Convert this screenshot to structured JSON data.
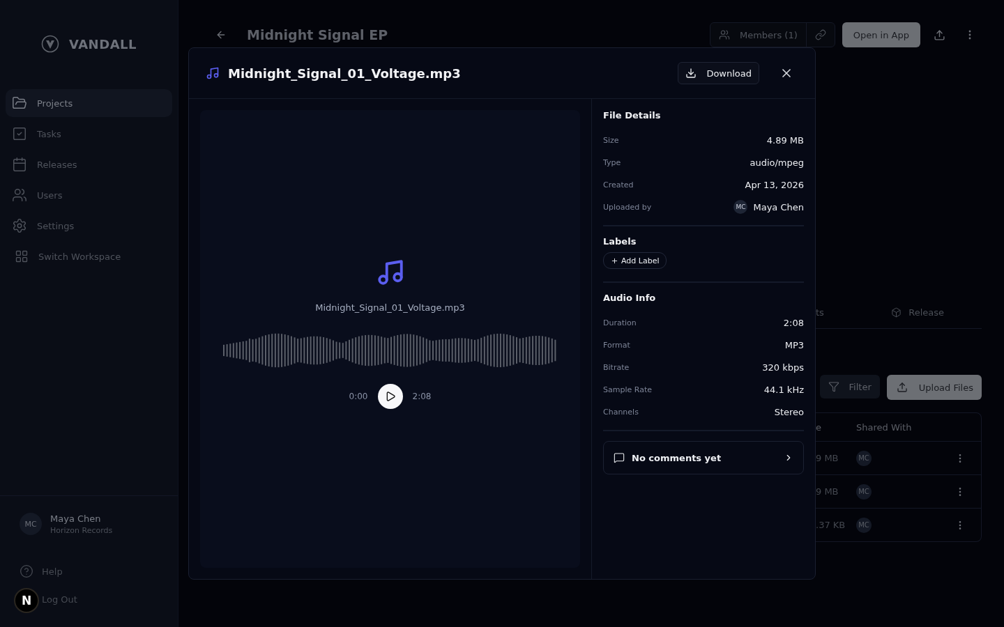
{
  "sidebar": {
    "brand": "VANDALL",
    "items": [
      {
        "label": "Projects",
        "selected": true
      },
      {
        "label": "Tasks",
        "selected": false
      },
      {
        "label": "Releases",
        "selected": false
      },
      {
        "label": "Users",
        "selected": false
      },
      {
        "label": "Settings",
        "selected": false
      },
      {
        "label": "Switch Workspace",
        "selected": false
      }
    ],
    "user": {
      "initials": "MC",
      "name": "Maya Chen",
      "organization": "Horizon Records"
    },
    "footer": [
      "Help",
      "Log Out"
    ],
    "dev_badge": "N"
  },
  "header": {
    "title": "Midnight Signal EP",
    "members": "Members (1)",
    "open_button": "Open in App"
  },
  "tabs": [
    "ts",
    "Release"
  ],
  "toolbar": {
    "filter": "Filter",
    "upload": "Upload Files"
  },
  "table": {
    "columns": [
      "e",
      "Shared With"
    ],
    "rows": [
      {
        "column_1": "9 MB",
        "shared_with": "MC"
      },
      {
        "column_1": "9 MB",
        "shared_with": "MC"
      },
      {
        "column_1": ".37 KB",
        "shared_with": "MC"
      }
    ]
  },
  "modal": {
    "title": "Midnight_Signal_01_Voltage.mp3",
    "download": "Download",
    "preview": {
      "filename": "Midnight_Signal_01_Voltage.mp3",
      "current_time": "0:00",
      "duration": "2:08"
    },
    "file_details": {
      "heading": "File Details",
      "rows": [
        {
          "label": "Size",
          "value": "4.89 MB"
        },
        {
          "label": "Type",
          "value": "audio/mpeg"
        },
        {
          "label": "Created",
          "value": "Apr 13, 2026"
        },
        {
          "label": "Uploaded by",
          "value": "Maya Chen",
          "avatar": "MC"
        }
      ]
    },
    "labels": {
      "heading": "Labels",
      "add": "Add Label"
    },
    "audio_info": {
      "heading": "Audio Info",
      "rows": [
        {
          "label": "Duration",
          "value": "2:08"
        },
        {
          "label": "Format",
          "value": "MP3"
        },
        {
          "label": "Bitrate",
          "value": "320 kbps"
        },
        {
          "label": "Sample Rate",
          "value": "44.1 kHz"
        },
        {
          "label": "Channels",
          "value": "Stereo"
        }
      ]
    },
    "comments": "No comments yet"
  }
}
